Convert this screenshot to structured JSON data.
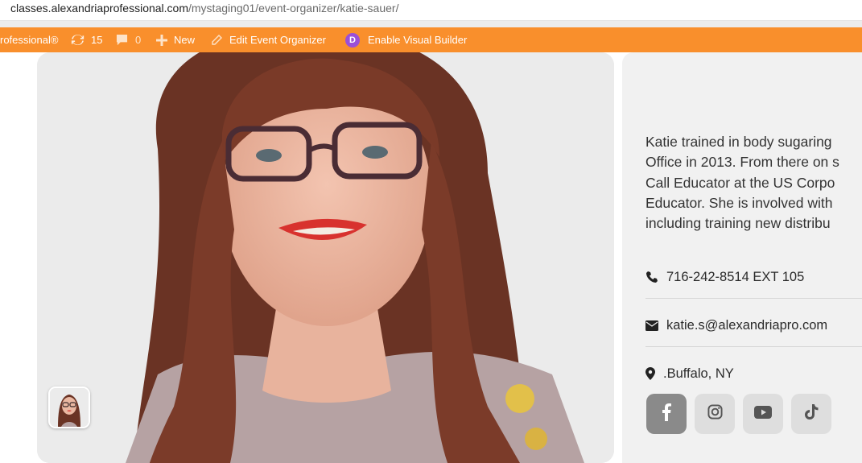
{
  "browser": {
    "url_host": "classes.alexandriaprofessional.com",
    "url_path": "/mystaging01/event-organizer/katie-sauer/"
  },
  "admin_bar": {
    "site_name": "rofessional®",
    "updates_count": "15",
    "comments_count": "0",
    "new_label": "New",
    "edit_label": "Edit Event Organizer",
    "divi_letter": "D",
    "visual_builder_label": "Enable Visual Builder",
    "color": "#f98f2c"
  },
  "bio_lines": [
    "Katie trained in body sugaring",
    "Office in 2013. From there on s",
    "Call Educator at the US Corpo",
    "Educator. She is involved with",
    "including training new distribu"
  ],
  "contact": {
    "phone": "716-242-8514 EXT 105",
    "email": "katie.s@alexandriapro.com",
    "location": ".Buffalo, NY"
  },
  "social": [
    {
      "name": "facebook-icon",
      "active": true
    },
    {
      "name": "instagram-icon",
      "active": false
    },
    {
      "name": "youtube-icon",
      "active": false
    },
    {
      "name": "tiktok-icon",
      "active": false
    }
  ]
}
